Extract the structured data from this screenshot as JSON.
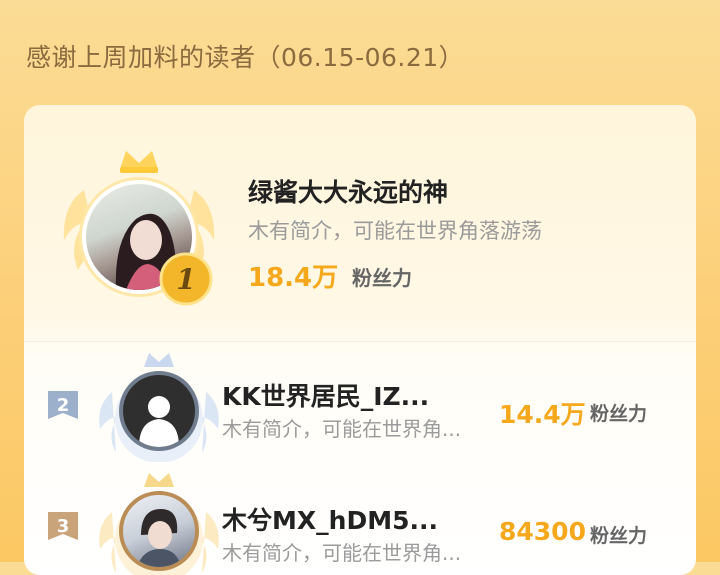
{
  "header": {
    "title": "感谢上周加料的读者（06.15-06.21）"
  },
  "fans_label": "粉丝力",
  "readers": [
    {
      "rank": "1",
      "name": "绿酱大大永远的神",
      "bio": "木有简介，可能在世界角落游荡",
      "fans": "18.4万"
    },
    {
      "rank": "2",
      "name": "KK世界居民_IZ...",
      "bio": "木有简介，可能在世界角...",
      "fans": "14.4万"
    },
    {
      "rank": "3",
      "name": "木兮MX_hDM5...",
      "bio": "木有简介，可能在世界角...",
      "fans": "84300"
    }
  ],
  "colors": {
    "accent": "#f5a81b",
    "background": "#fcd47e",
    "header_text": "#8a6a3f"
  }
}
